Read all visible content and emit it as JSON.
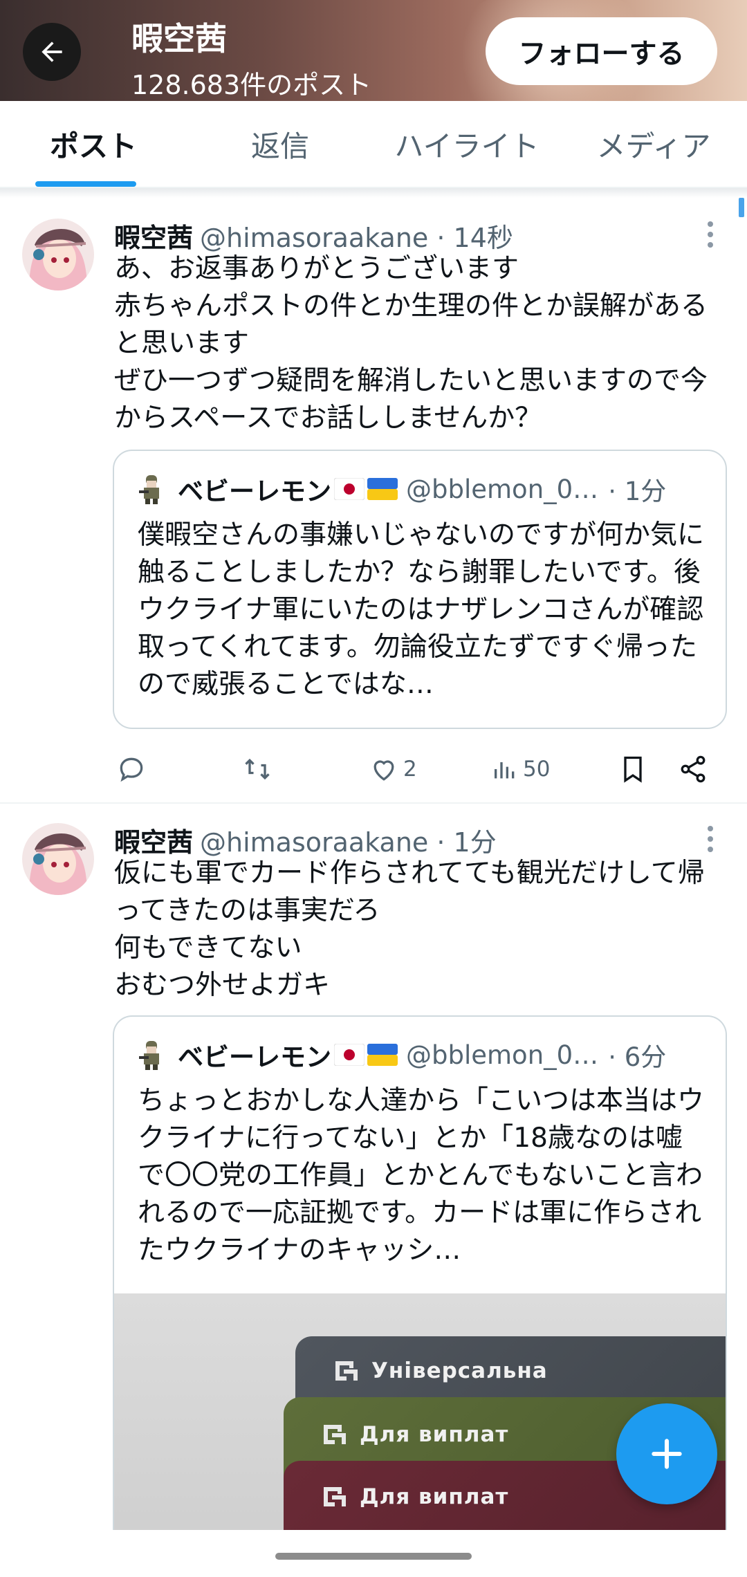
{
  "header": {
    "title": "暇空茜",
    "post_count": "128.683件のポスト",
    "follow_label": "フォローする"
  },
  "tabs": [
    {
      "label": "ポスト",
      "active": true
    },
    {
      "label": "返信",
      "active": false
    },
    {
      "label": "ハイライト",
      "active": false
    },
    {
      "label": "メディア",
      "active": false
    }
  ],
  "posts": [
    {
      "name": "暇空茜",
      "handle": "@himasoraakane · 14秒",
      "body": "あ、お返事ありがとうございます\n赤ちゃんポストの件とか生理の件とか誤解があると思います\nぜひ一つずつ疑問を解消したいと思いますので今からスペースでお話ししませんか？",
      "quote": {
        "name": "ベビーレモン",
        "handle": "@bblemon_0…",
        "time": "· 1分",
        "body": "僕暇空さんの事嫌いじゃないのですが何か気に触ることしましたか？なら謝罪したいです。後ウクライナ軍にいたのはナザレンコさんが確認取ってくれてます。勿論役立たずですぐ帰ったので威張ることではな…"
      },
      "likes": "2",
      "views": "50"
    },
    {
      "name": "暇空茜",
      "handle": "@himasoraakane · 1分",
      "body": "仮にも軍でカード作らされてても観光だけして帰ってきたのは事実だろ\n何もできてない\nおむつ外せよガキ",
      "quote": {
        "name": "ベビーレモン",
        "handle": "@bblemon_0…",
        "time": "· 6分",
        "body": "ちょっとおかしな人達から「こいつは本当はウクライナに行ってない」とか「18歳なのは嘘で〇〇党の工作員」とかとんでもないこと言われるので一応証拠です。カードは軍に作らされたウクライナのキャッシ…",
        "cards": [
          "Універсальна",
          "Для виплат",
          "Для виплат"
        ]
      }
    }
  ],
  "colors": {
    "accent": "#1d9bf0",
    "text": "#0f1419",
    "secondary": "#536471"
  }
}
